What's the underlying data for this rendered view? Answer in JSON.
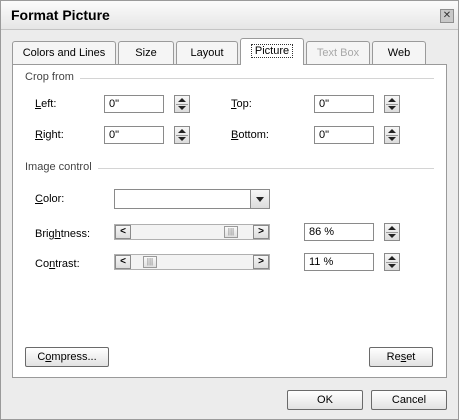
{
  "window": {
    "title": "Format Picture",
    "close_glyph": "✕"
  },
  "tabs": [
    {
      "label": "Colors and Lines",
      "state": "normal"
    },
    {
      "label": "Size",
      "state": "normal"
    },
    {
      "label": "Layout",
      "state": "normal"
    },
    {
      "label": "Picture",
      "state": "active"
    },
    {
      "label": "Text Box",
      "state": "disabled"
    },
    {
      "label": "Web",
      "state": "normal"
    }
  ],
  "crop": {
    "section_title": "Crop from",
    "left": {
      "label_pre": "",
      "label_u": "L",
      "label_post": "eft:",
      "value": "0\""
    },
    "top": {
      "label_pre": "",
      "label_u": "T",
      "label_post": "op:",
      "value": "0\""
    },
    "right": {
      "label_pre": "",
      "label_u": "R",
      "label_post": "ight:",
      "value": "0\""
    },
    "bottom": {
      "label_pre": "",
      "label_u": "B",
      "label_post": "ottom:",
      "value": "0\""
    }
  },
  "image_control": {
    "section_title": "Image control",
    "color": {
      "label_pre": "",
      "label_u": "C",
      "label_post": "olor:",
      "value": ""
    },
    "brightness": {
      "label_pre": "Brig",
      "label_u": "h",
      "label_post": "tness:",
      "value": "86 %",
      "level": 0.86
    },
    "contrast": {
      "label_pre": "Co",
      "label_u": "n",
      "label_post": "trast:",
      "value": "11 %",
      "level": 0.11
    },
    "slider_left_glyph": "<",
    "slider_right_glyph": ">",
    "thumb_glyph": "|||"
  },
  "buttons": {
    "compress": {
      "pre": "C",
      "u": "o",
      "post": "mpress..."
    },
    "reset": {
      "pre": "Re",
      "u": "s",
      "post": "et"
    },
    "ok": "OK",
    "cancel": "Cancel"
  }
}
